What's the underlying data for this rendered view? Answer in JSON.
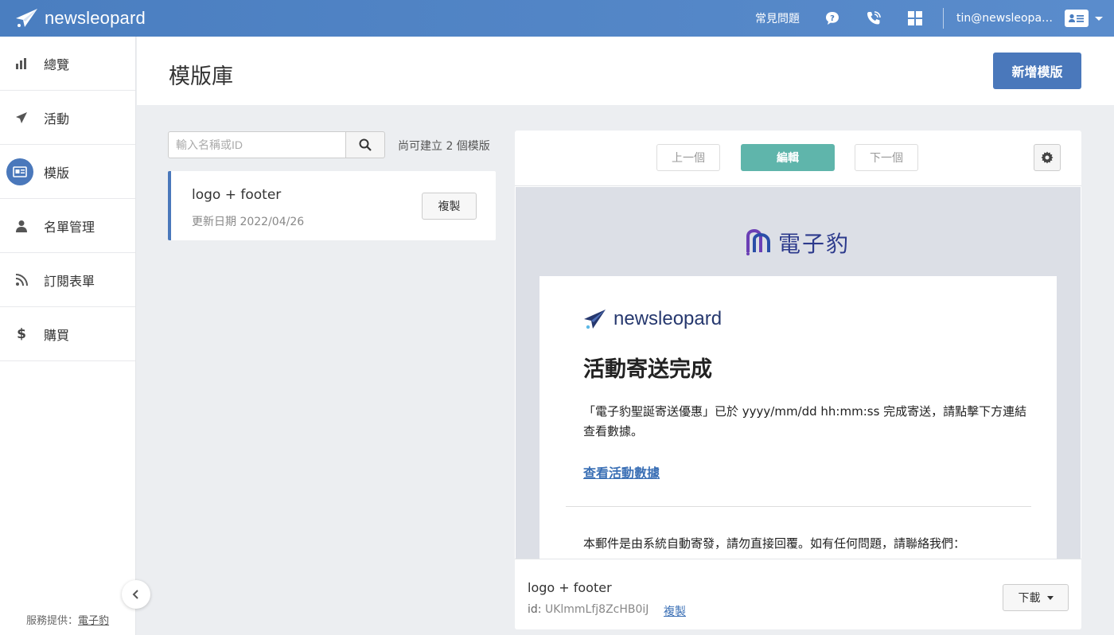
{
  "topbar": {
    "brand": "newsleopard",
    "faq": "常見問題",
    "user_email": "tin@newsleopard.com",
    "icons": [
      "question-icon",
      "phone-icon",
      "grid-icon",
      "user-card-icon"
    ]
  },
  "sidebar": {
    "items": [
      {
        "label": "總覽",
        "icon": "bar-chart-icon"
      },
      {
        "label": "活動",
        "icon": "paper-plane-icon"
      },
      {
        "label": "模版",
        "icon": "template-icon"
      },
      {
        "label": "名單管理",
        "icon": "user-icon"
      },
      {
        "label": "訂閱表單",
        "icon": "rss-icon"
      },
      {
        "label": "購買",
        "icon": "dollar-icon"
      }
    ],
    "active_index": 2,
    "footer_prefix": "服務提供：",
    "footer_link": "電子豹"
  },
  "header": {
    "title": "模版庫",
    "add_button": "新增模版"
  },
  "search": {
    "placeholder": "輸入名稱或ID",
    "hint": "尚可建立 2 個模版"
  },
  "templates": [
    {
      "name": "logo + footer",
      "date": "更新日期 2022/04/26",
      "copy_label": "複製"
    }
  ],
  "preview": {
    "prev_label": "上一個",
    "edit_label": "編輯",
    "next_label": "下一個",
    "email": {
      "top_logo_text": "電子豹",
      "brand": "newsleopard",
      "heading": "活動寄送完成",
      "body": "「電子豹聖誕寄送優惠」已於 yyyy/mm/dd hh:mm:ss 完成寄送，請點擊下方連結查看數據。",
      "link": "查看活動數據",
      "footer": "本郵件是由系統自動寄發，請勿直接回覆。如有任何問題，請聯絡我們："
    },
    "footer": {
      "name": "logo + footer",
      "id_label": "id: ",
      "id_value": "UKlmmLfj8ZcHB0iJ",
      "copy_label": "複製",
      "download_label": "下載"
    }
  },
  "colors": {
    "primary": "#4a78bb",
    "edit": "#5fb5ab",
    "topbar": "#4a7ec0"
  }
}
